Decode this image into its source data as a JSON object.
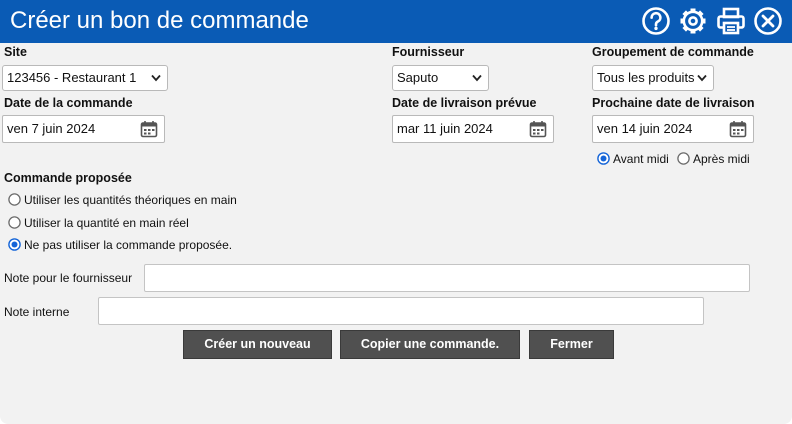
{
  "window": {
    "title": "Créer un bon de commande"
  },
  "header_icons": [
    "help-icon",
    "settings-gear-icon",
    "print-icon",
    "close-icon"
  ],
  "colors": {
    "title_bar": "#0a5bb5",
    "button_bg": "#505050",
    "radio_accent": "#1565d8"
  },
  "site": {
    "label": "Site",
    "selected": "123456 - Restaurant 1"
  },
  "supplier": {
    "label": "Fournisseur",
    "selected": "Saputo"
  },
  "grouping": {
    "label": "Groupement de commande",
    "selected": "Tous les produits"
  },
  "order_date": {
    "label": "Date de la commande",
    "value": "ven 7 juin 2024"
  },
  "delivery_date": {
    "label": "Date de livraison prévue",
    "value": "mar 11 juin 2024"
  },
  "next_delivery": {
    "label": "Prochaine date de livraison",
    "value": "ven 14 juin 2024",
    "options": [
      {
        "label": "Avant midi",
        "checked": true
      },
      {
        "label": "Après midi",
        "checked": false
      }
    ]
  },
  "proposed_order": {
    "label": "Commande proposée",
    "options": [
      {
        "label": "Utiliser les quantités théoriques en main",
        "checked": false
      },
      {
        "label": "Utiliser la quantité en main réel",
        "checked": false
      },
      {
        "label": "Ne pas utiliser la commande proposée.",
        "checked": true
      }
    ]
  },
  "supplier_note": {
    "label": "Note pour le fournisseur",
    "value": ""
  },
  "internal_note": {
    "label": "Note interne",
    "value": ""
  },
  "buttons": {
    "create_new": "Créer un nouveau",
    "copy_order": "Copier une commande.",
    "close": "Fermer"
  }
}
